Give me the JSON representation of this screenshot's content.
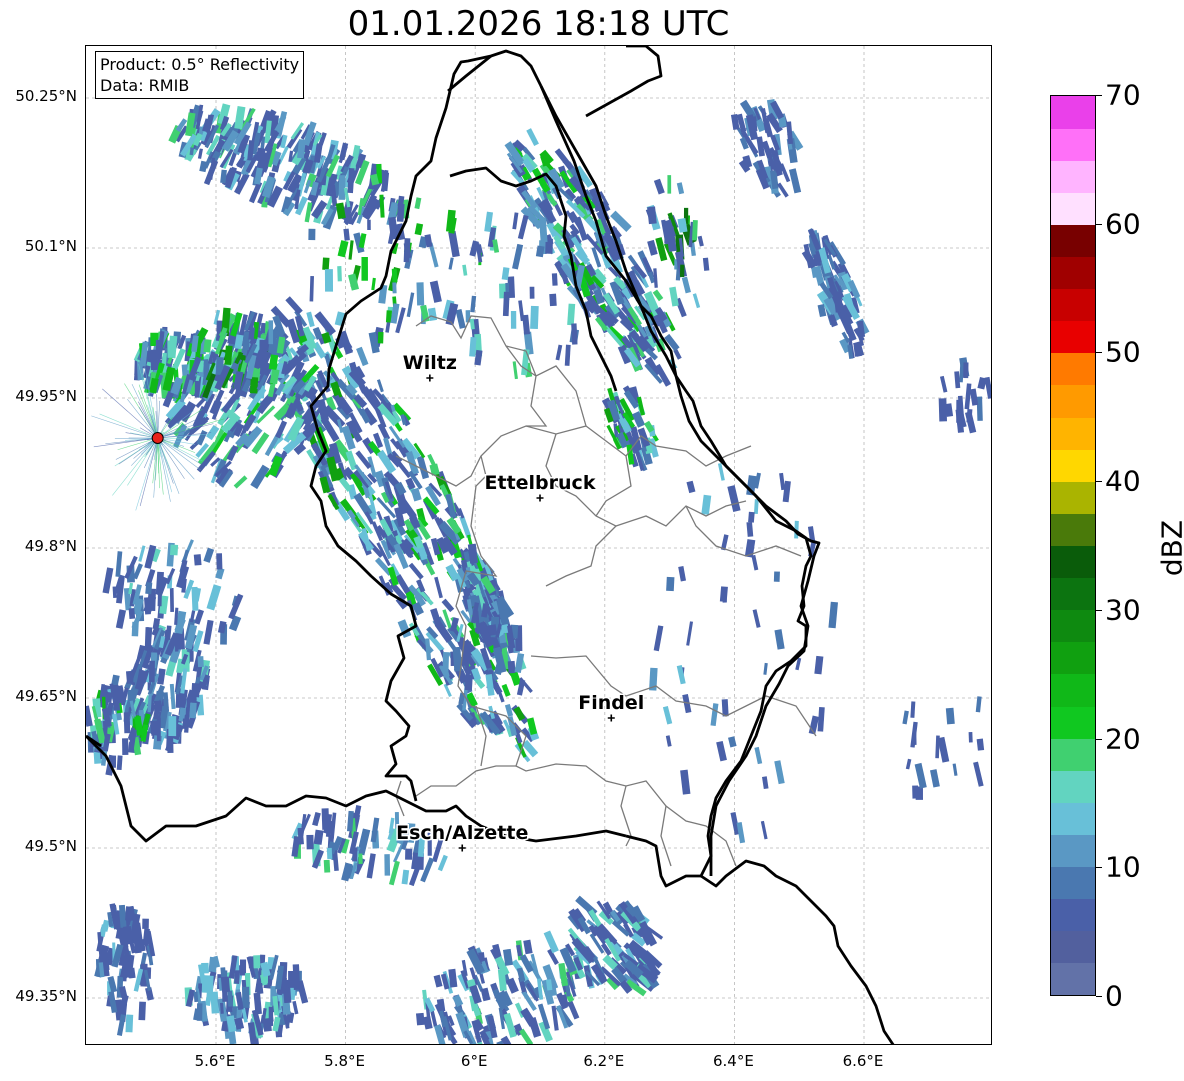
{
  "title": "01.01.2026 18:18 UTC",
  "info": {
    "product": "Product: 0.5° Reflectivity",
    "source": "Data: RMIB"
  },
  "axes": {
    "lat_labels": [
      "50.25°N",
      "50.1°N",
      "49.95°N",
      "49.8°N",
      "49.65°N",
      "49.5°N",
      "49.35°N"
    ],
    "lon_labels": [
      "5.6°E",
      "5.8°E",
      "6°E",
      "6.2°E",
      "6.4°E",
      "6.6°E"
    ],
    "grid": true
  },
  "cities": [
    {
      "name": "Wiltz",
      "lon": 5.93,
      "lat": 49.97
    },
    {
      "name": "Ettelbruck",
      "lon": 6.1,
      "lat": 49.85
    },
    {
      "name": "Findel",
      "lon": 6.21,
      "lat": 49.63
    },
    {
      "name": "Esch/Alzette",
      "lon": 5.98,
      "lat": 49.5
    }
  ],
  "radar_site": {
    "lon": 5.51,
    "lat": 49.91,
    "color": "#e8201a"
  },
  "colorbar": {
    "unit": "dBZ",
    "min": 0,
    "max": 70,
    "tick_labels": [
      "0",
      "10",
      "20",
      "30",
      "40",
      "50",
      "60",
      "70"
    ],
    "colors": [
      "#6272a8",
      "#52609e",
      "#4a60a8",
      "#4a78b0",
      "#5a98c4",
      "#68c0d8",
      "#62d4c0",
      "#40d070",
      "#10c820",
      "#10b818",
      "#10a010",
      "#0e8a10",
      "#0c7410",
      "#0a5c0a",
      "#4a7a0a",
      "#aab400",
      "#ffd700",
      "#ffb400",
      "#ff9a00",
      "#ff7a00",
      "#e80000",
      "#c80000",
      "#a00000",
      "#780000",
      "#ffe0ff",
      "#ffb4ff",
      "#ff70f8",
      "#ea40ea"
    ]
  }
}
